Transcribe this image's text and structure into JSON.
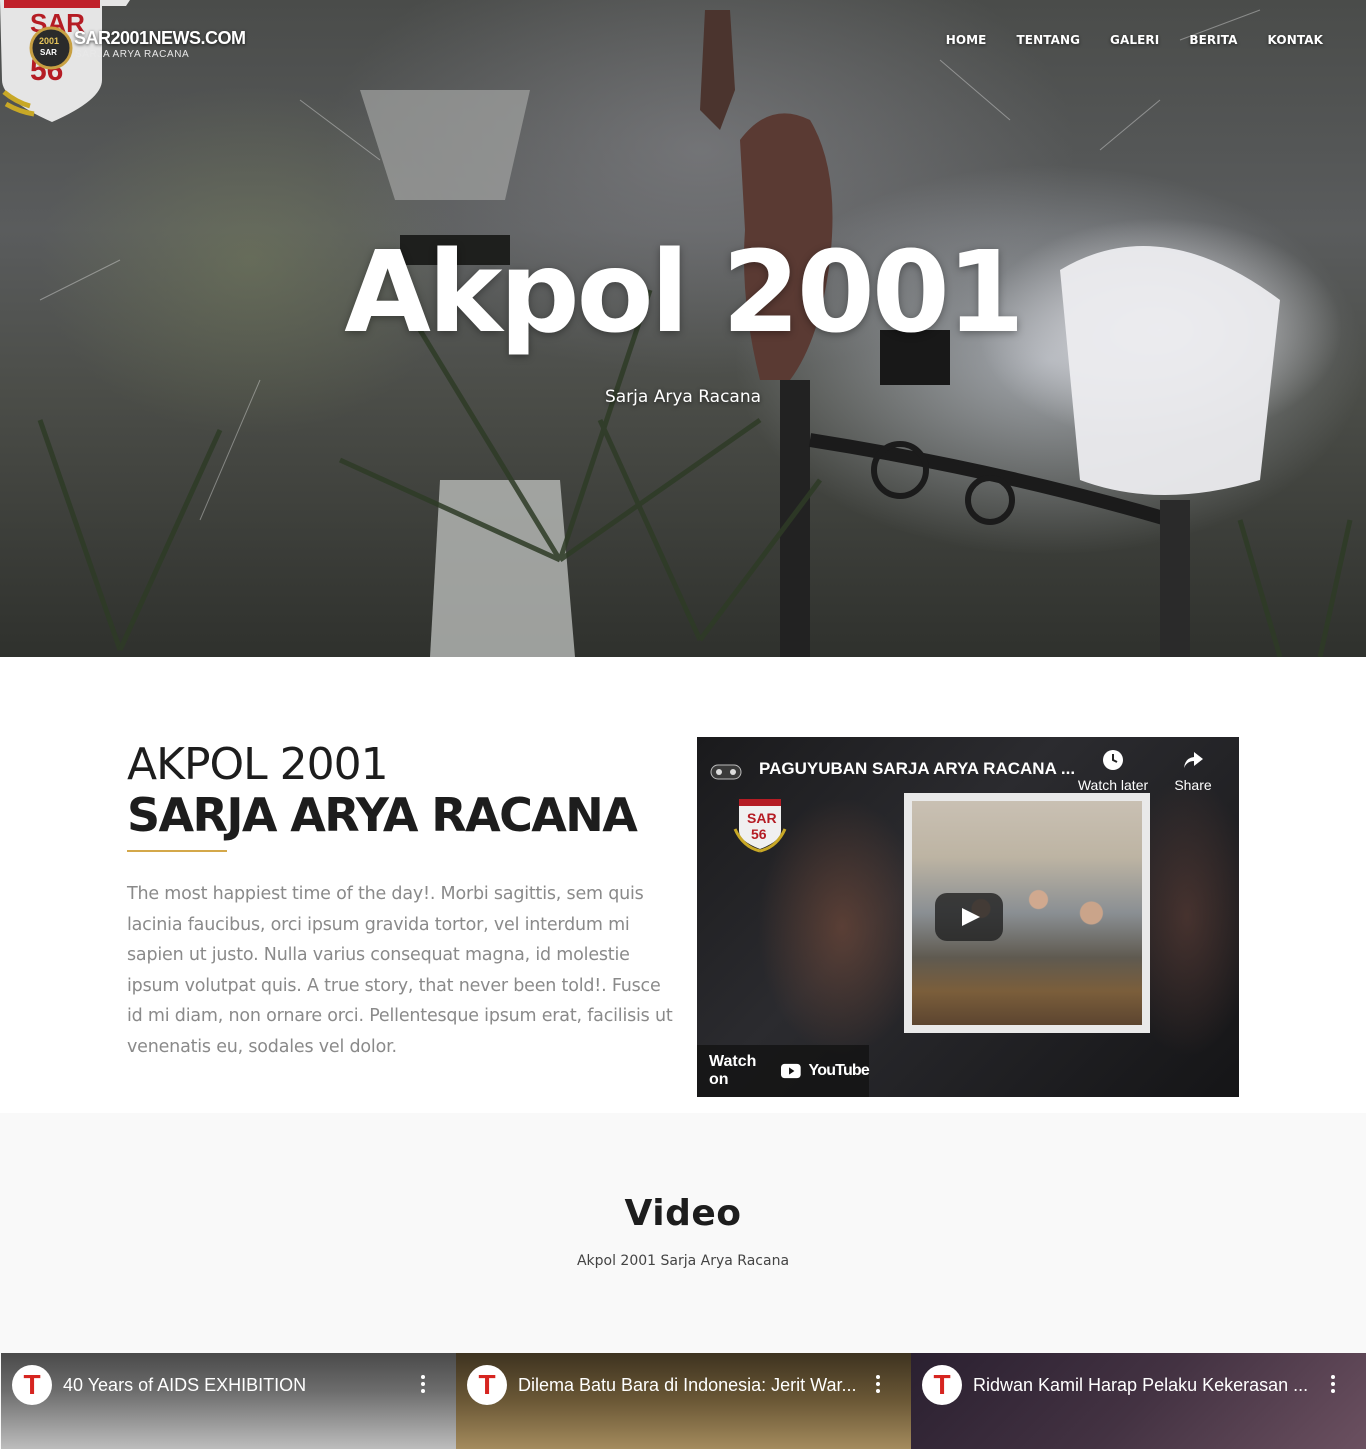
{
  "header": {
    "site_title": "SAR2001NEWS.COM",
    "tagline": "SARJA ARYA RACANA",
    "nav": [
      "HOME",
      "TENTANG",
      "GALERI",
      "BERITA",
      "KONTAK"
    ]
  },
  "hero": {
    "title": "Akpol 2001",
    "subtitle": "Sarja Arya Racana"
  },
  "about": {
    "heading_line1": "AKPOL 2001",
    "heading_line2": "SARJA ARYA RACANA",
    "paragraph": "The most happiest time of the day!. Morbi sagittis, sem quis lacinia faucibus, orci ipsum gravida tortor, vel interdum mi sapien ut justo. Nulla varius consequat magna, id molestie ipsum volutpat quis. A true story, that never been told!. Fusce id mi diam, non ornare orci. Pellentesque ipsum erat, facilisis ut venenatis eu, sodales vel dolor."
  },
  "embed": {
    "title": "PAGUYUBAN SARJA ARYA RACANA ...",
    "watch_later": "Watch later",
    "share": "Share",
    "watch_on": "Watch on",
    "youtube": "YouTube"
  },
  "video_section": {
    "heading": "Video",
    "subheading": "Akpol 2001 Sarja Arya Racana",
    "videos": [
      {
        "title": "40 Years of AIDS EXHIBITION",
        "channel_initial": "T"
      },
      {
        "title": "Dilema Batu Bara di Indonesia: Jerit War...",
        "channel_initial": "T"
      },
      {
        "title": "Ridwan Kamil Harap Pelaku Kekerasan ...",
        "channel_initial": "T"
      }
    ]
  },
  "colors": {
    "accent_line": "#d4a84a",
    "text_dark": "#1d1d1d",
    "text_muted": "#8a8a8a",
    "section_bg": "#f9f9f9",
    "tempo_red": "#d62520"
  }
}
